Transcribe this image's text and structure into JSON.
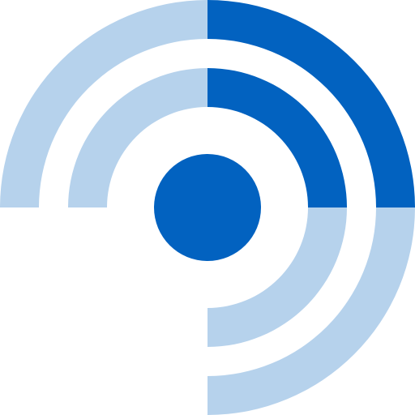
{
  "icon": {
    "name": "signal-broadcast-icon",
    "colors": {
      "background": "#ffffff",
      "primary": "#0262c0",
      "secondary": "#b6d2ec"
    },
    "rings": [
      {
        "ring": "outer",
        "quadrants": {
          "top-left": "secondary",
          "top-right": "primary",
          "bottom-right": "secondary",
          "bottom-left": "none"
        }
      },
      {
        "ring": "inner",
        "quadrants": {
          "top-left": "secondary",
          "top-right": "primary",
          "bottom-right": "secondary",
          "bottom-left": "none"
        }
      }
    ],
    "center_dot": "primary"
  }
}
